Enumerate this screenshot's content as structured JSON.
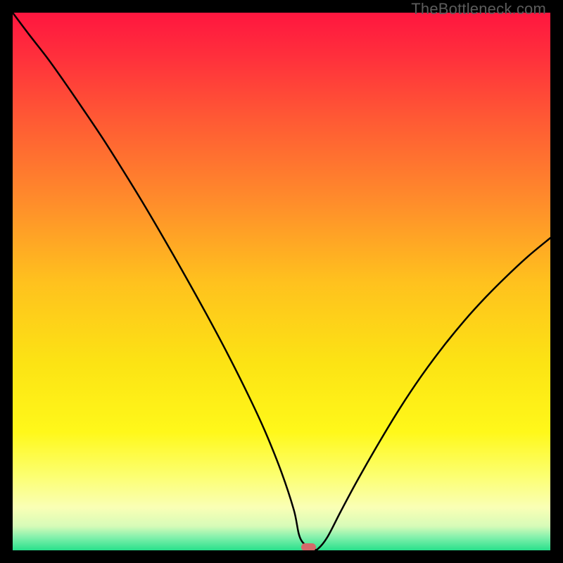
{
  "watermark": {
    "text": "TheBottleneck.com"
  },
  "chart_data": {
    "type": "line",
    "title": "",
    "xlabel": "",
    "ylabel": "",
    "xlim": [
      0,
      100
    ],
    "ylim": [
      0,
      100
    ],
    "grid": false,
    "background_gradient": {
      "stops": [
        {
          "offset": 0.0,
          "color": "#ff163f"
        },
        {
          "offset": 0.08,
          "color": "#ff2f3c"
        },
        {
          "offset": 0.2,
          "color": "#ff5a34"
        },
        {
          "offset": 0.35,
          "color": "#ff8c2b"
        },
        {
          "offset": 0.5,
          "color": "#ffc11e"
        },
        {
          "offset": 0.65,
          "color": "#fce314"
        },
        {
          "offset": 0.78,
          "color": "#fff81a"
        },
        {
          "offset": 0.86,
          "color": "#fcff6f"
        },
        {
          "offset": 0.92,
          "color": "#faffb5"
        },
        {
          "offset": 0.955,
          "color": "#d7fbb8"
        },
        {
          "offset": 0.975,
          "color": "#86f1ad"
        },
        {
          "offset": 1.0,
          "color": "#28e08b"
        }
      ]
    },
    "series": [
      {
        "name": "bottleneck-curve",
        "color": "#000000",
        "width": 2.5,
        "x": [
          0.0,
          3.0,
          6.5,
          9.5,
          13.0,
          16.5,
          20.0,
          24.0,
          28.0,
          32.0,
          36.0,
          40.0,
          44.0,
          47.0,
          50.0,
          52.3,
          53.6,
          56.0,
          56.8,
          58.5,
          61.0,
          64.0,
          68.0,
          72.0,
          76.0,
          80.0,
          84.0,
          88.0,
          92.0,
          96.0,
          100.0
        ],
        "y": [
          100.0,
          96.0,
          91.5,
          87.3,
          82.2,
          77.0,
          71.5,
          65.0,
          58.2,
          51.2,
          44.0,
          36.5,
          28.5,
          22.0,
          14.5,
          7.5,
          2.0,
          0.3,
          0.3,
          2.4,
          7.2,
          12.8,
          19.8,
          26.4,
          32.4,
          37.8,
          42.7,
          47.1,
          51.1,
          54.8,
          58.1
        ]
      }
    ],
    "marker": {
      "x": 55.0,
      "y": 0.6,
      "width_pct": 2.8,
      "height_pct": 1.35,
      "color": "#d46a6a"
    }
  }
}
